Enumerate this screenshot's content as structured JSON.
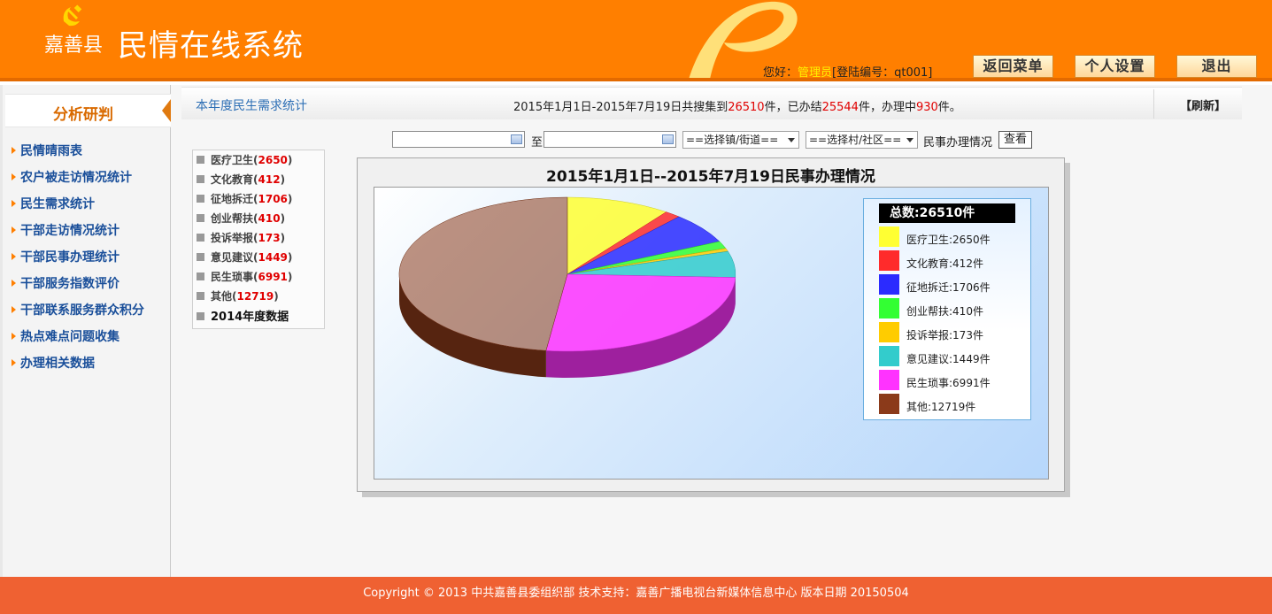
{
  "header": {
    "county": "嘉善县",
    "system_name": "民情在线系统",
    "greeting_prefix": "您好：",
    "user_role": "管理员",
    "login_info": "[登陆编号：qt001]",
    "buttons": [
      "返回菜单",
      "个人设置",
      "退出"
    ]
  },
  "sidebar": {
    "title": "分析研判",
    "items": [
      "民情晴雨表",
      "农户被走访情况统计",
      "民生需求统计",
      "干部走访情况统计",
      "干部民事办理统计",
      "干部服务指数评价",
      "干部联系服务群众积分",
      "热点难点问题收集",
      "办理相关数据"
    ]
  },
  "bar": {
    "title": "本年度民生需求统计",
    "summary_prefix": "2015年1月1日-2015年7月19日共搜集到",
    "collected": "26510",
    "summary_mid1": "件，已办结",
    "completed": "25544",
    "summary_mid2": "件，办理中",
    "in_progress": "930",
    "summary_suffix": "件。",
    "refresh": "【刷新】"
  },
  "filters": {
    "to_label": "至",
    "town_select": "==选择镇/街道==",
    "village_select": "==选择村/社区==",
    "type_label": "民事办理情况",
    "view_button": "查看"
  },
  "categories": [
    {
      "name": "医疗卫生",
      "count": "2650"
    },
    {
      "name": "文化教育",
      "count": "412"
    },
    {
      "name": "征地拆迁",
      "count": "1706"
    },
    {
      "name": "创业帮扶",
      "count": "410"
    },
    {
      "name": "投诉举报",
      "count": "173"
    },
    {
      "name": "意见建议",
      "count": "1449"
    },
    {
      "name": "民生琐事",
      "count": "6991"
    },
    {
      "name": "其他",
      "count": "12719"
    }
  ],
  "year_data_link": "2014年度数据",
  "chart_data": {
    "type": "pie",
    "title": "2015年1月1日--2015年7月19日民事办理情况",
    "total_label": "总数:26510件",
    "categories": [
      "医疗卫生",
      "文化教育",
      "征地拆迁",
      "创业帮扶",
      "投诉举报",
      "意见建议",
      "民生琐事",
      "其他"
    ],
    "values": [
      2650,
      412,
      1706,
      410,
      173,
      1449,
      6991,
      12719
    ],
    "legend_labels": [
      "医疗卫生:2650件",
      "文化教育:412件",
      "征地拆迁:1706件",
      "创业帮扶:410件",
      "投诉举报:173件",
      "意见建议:1449件",
      "民生琐事:6991件",
      "其他:12719件"
    ],
    "colors": [
      "#ffff33",
      "#ff2b2b",
      "#2b2bff",
      "#33ff33",
      "#ffcc00",
      "#33cccc",
      "#ff33ff",
      "#8b3a1a"
    ],
    "legend_position": "right"
  },
  "footer": {
    "text": "Copyright © 2013 中共嘉善县委组织部  技术支持：嘉善广播电视台新媒体信息中心  版本日期 20150504"
  },
  "colors": {
    "header_bg": "#ff7f00",
    "footer_bg": "#ef6132",
    "accent_red": "#e00000",
    "link_blue": "#1a4f9a"
  }
}
